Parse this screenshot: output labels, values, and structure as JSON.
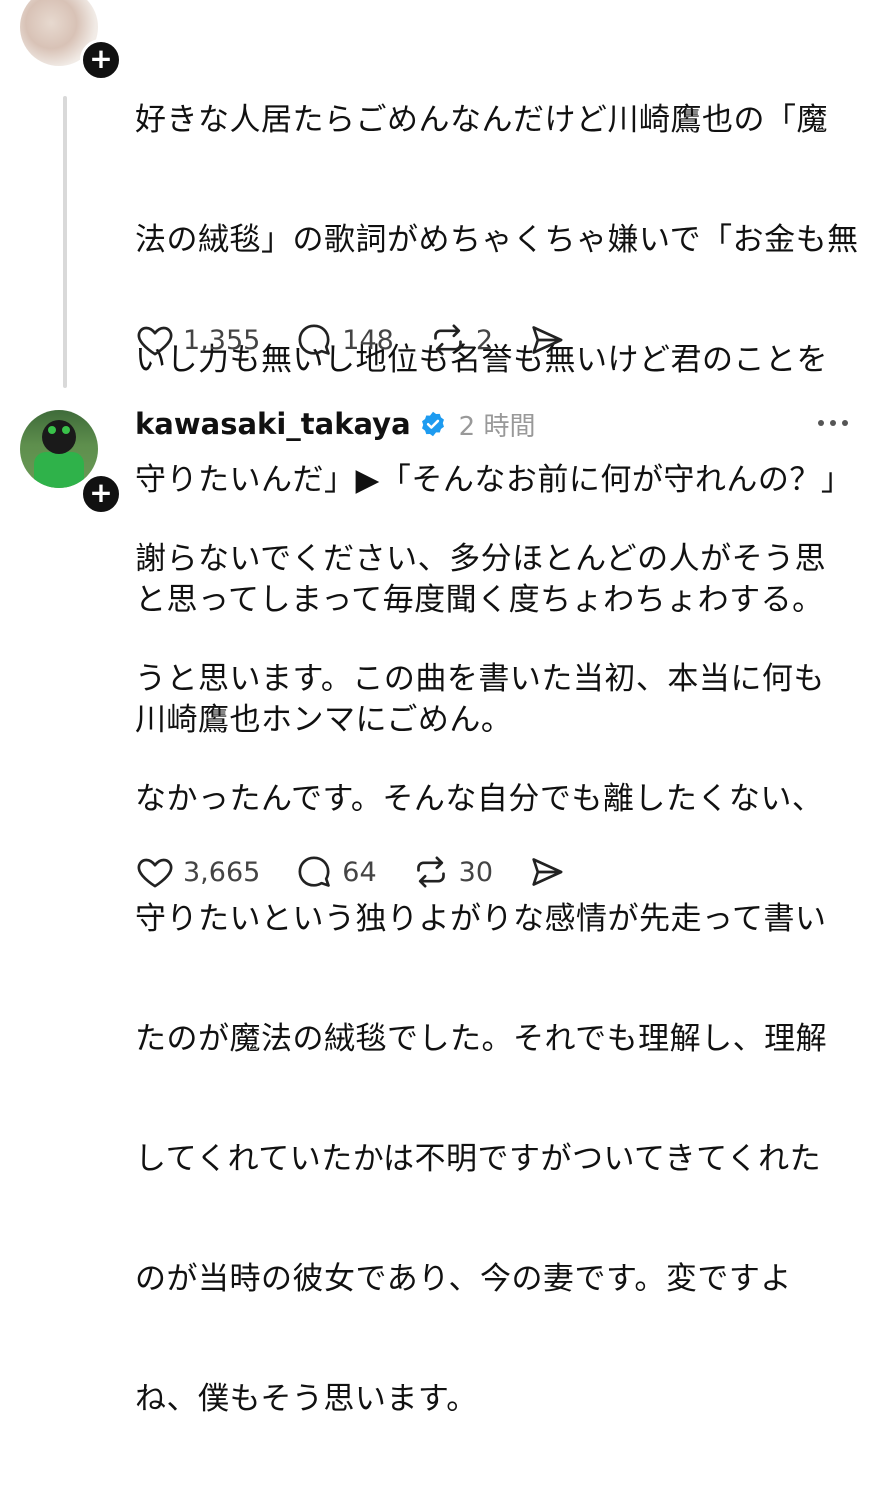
{
  "post1": {
    "lines": [
      "好きな人居たらごめんなんだけど川崎鷹也の「魔",
      "法の絨毯」の歌詞がめちゃくちゃ嫌いで「お金も無",
      "いし力も無いし地位も名誉も無いけど君のことを",
      "守りたいんだ」▶「そんなお前に何が守れんの？」",
      "と思ってしまって毎度聞く度ちょわちょわする。",
      "川崎鷹也ホンマにごめん。"
    ],
    "likes": "1,355",
    "replies": "148",
    "reposts": "2"
  },
  "post2": {
    "username": "kawasaki_takaya",
    "time": "2 時間",
    "lines": [
      "謝らないでください、多分ほとんどの人がそう思",
      "うと思います。この曲を書いた当初、本当に何も",
      "なかったんです。そんな自分でも離したくない、",
      "守りたいという独りよがりな感情が先走って書い",
      "たのが魔法の絨毯でした。それでも理解し、理解",
      "してくれていたかは不明ですがついてきてくれた",
      "のが当時の彼女であり、今の妻です。変ですよ",
      "ね、僕もそう思います。"
    ],
    "likes": "3,665",
    "replies": "64",
    "reposts": "30"
  },
  "icons": [
    "heart-icon",
    "comment-icon",
    "repost-icon",
    "send-icon",
    "verified-badge-icon",
    "more-icon",
    "follow-plus-icon"
  ],
  "colors": {
    "verified": "#1d9bf0",
    "text": "#111111",
    "muted": "#999999"
  }
}
